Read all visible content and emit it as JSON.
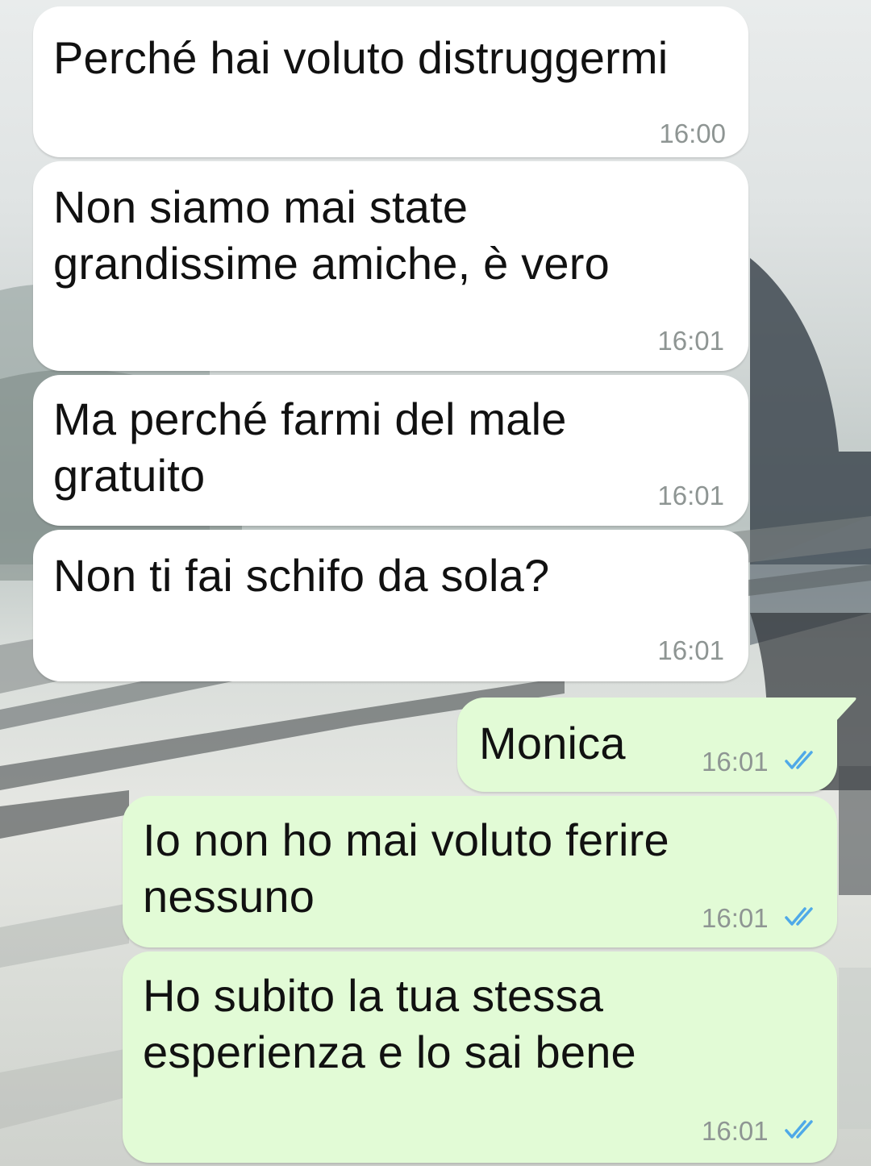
{
  "chat": {
    "messages": [
      {
        "direction": "in",
        "text": "Perché hai voluto distruggermi",
        "time": "16:00"
      },
      {
        "direction": "in",
        "text": "Non siamo mai state\ngrandissime amiche, è vero",
        "time": "16:01"
      },
      {
        "direction": "in",
        "text": "Ma perché farmi del male\ngratuito",
        "time": "16:01"
      },
      {
        "direction": "in",
        "text": "Non ti fai schifo da sola?",
        "time": "16:01"
      },
      {
        "direction": "out",
        "text": "Monica",
        "time": "16:01",
        "status": "read",
        "status_icon": "double-check-icon"
      },
      {
        "direction": "out",
        "text": "Io non ho mai voluto ferire\nnessuno",
        "time": "16:01",
        "status": "read",
        "status_icon": "double-check-icon"
      },
      {
        "direction": "out",
        "text": "Ho subito la tua stessa\nesperienza e lo sai bene",
        "time": "16:01",
        "status": "read",
        "status_icon": "double-check-icon"
      }
    ]
  },
  "colors": {
    "incoming_bubble": "#ffffff",
    "outgoing_bubble": "#e2fbd6",
    "timestamp": "#8e9593",
    "read_ticks": "#4fa9e8"
  }
}
